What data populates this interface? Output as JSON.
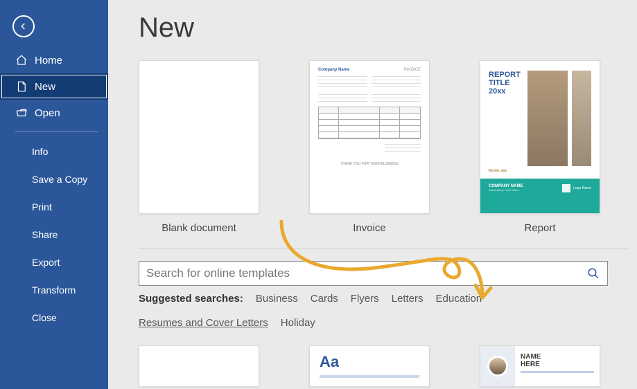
{
  "sidebar": {
    "groups_top": [
      {
        "label": "Home",
        "icon": "home-icon"
      },
      {
        "label": "New",
        "icon": "document-icon",
        "selected": true
      },
      {
        "label": "Open",
        "icon": "folder-open-icon"
      }
    ],
    "groups_bottom": [
      {
        "label": "Info"
      },
      {
        "label": "Save a Copy"
      },
      {
        "label": "Print"
      },
      {
        "label": "Share"
      },
      {
        "label": "Export"
      },
      {
        "label": "Transform"
      },
      {
        "label": "Close"
      }
    ]
  },
  "page": {
    "title": "New"
  },
  "templates": [
    {
      "label": "Blank document",
      "kind": "blank"
    },
    {
      "label": "Invoice",
      "kind": "invoice",
      "mock": {
        "brand": "Company Name",
        "header": "INVOICE",
        "footer": "THANK YOU FOR YOUR BUSINESS"
      }
    },
    {
      "label": "Report",
      "kind": "report",
      "mock": {
        "title1": "REPORT TITLE",
        "title2": "20xx",
        "company": "COMPANY NAME",
        "author": "Authored by: Your Name",
        "logo": "Logo\nName"
      }
    }
  ],
  "search": {
    "placeholder": "Search for online templates",
    "suggest_label": "Suggested searches:",
    "suggestions": [
      "Business",
      "Cards",
      "Flyers",
      "Letters",
      "Education",
      "Resumes and Cover Letters",
      "Holiday"
    ]
  },
  "bottom_templates": [
    {
      "kind": "plain"
    },
    {
      "kind": "aa",
      "text": "Aa"
    },
    {
      "kind": "resume",
      "name1": "NAME",
      "name2": "HERE"
    }
  ],
  "annotation": {
    "highlight_index": 5
  }
}
